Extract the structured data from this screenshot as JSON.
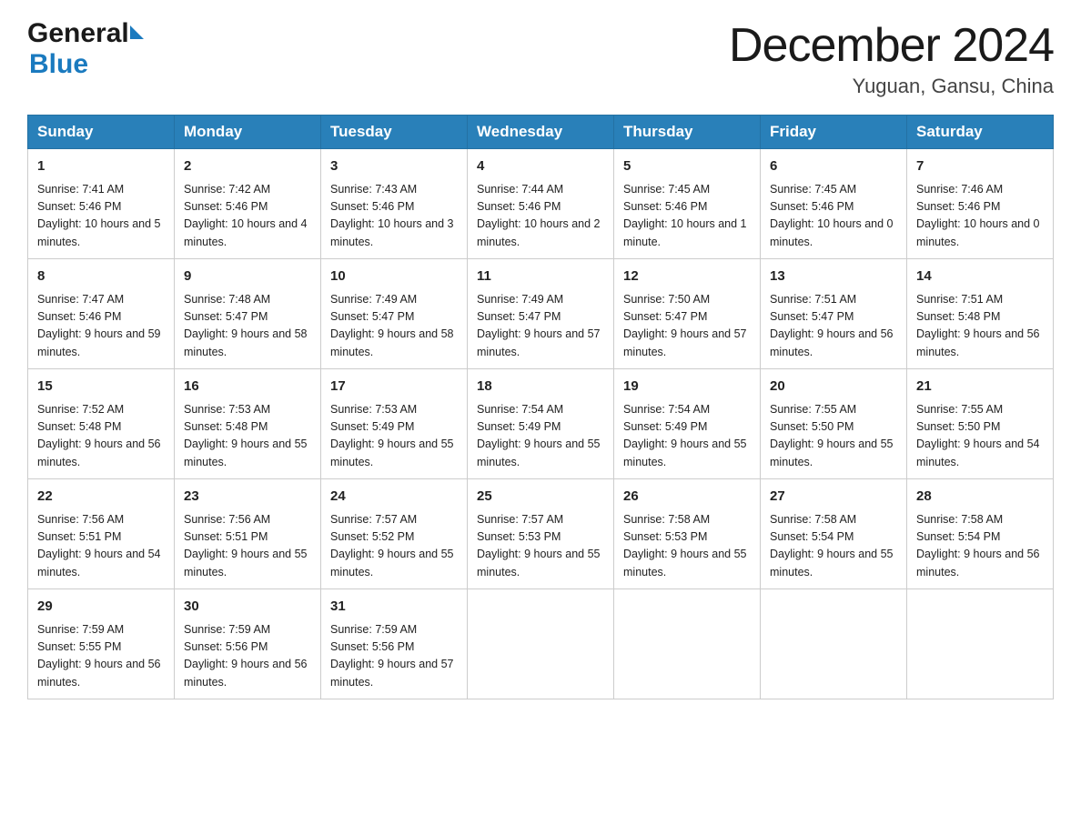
{
  "header": {
    "logo_general": "General",
    "logo_blue": "Blue",
    "month_title": "December 2024",
    "location": "Yuguan, Gansu, China"
  },
  "days_of_week": [
    "Sunday",
    "Monday",
    "Tuesday",
    "Wednesday",
    "Thursday",
    "Friday",
    "Saturday"
  ],
  "weeks": [
    [
      {
        "day": "1",
        "sunrise": "7:41 AM",
        "sunset": "5:46 PM",
        "daylight": "10 hours and 5 minutes."
      },
      {
        "day": "2",
        "sunrise": "7:42 AM",
        "sunset": "5:46 PM",
        "daylight": "10 hours and 4 minutes."
      },
      {
        "day": "3",
        "sunrise": "7:43 AM",
        "sunset": "5:46 PM",
        "daylight": "10 hours and 3 minutes."
      },
      {
        "day": "4",
        "sunrise": "7:44 AM",
        "sunset": "5:46 PM",
        "daylight": "10 hours and 2 minutes."
      },
      {
        "day": "5",
        "sunrise": "7:45 AM",
        "sunset": "5:46 PM",
        "daylight": "10 hours and 1 minute."
      },
      {
        "day": "6",
        "sunrise": "7:45 AM",
        "sunset": "5:46 PM",
        "daylight": "10 hours and 0 minutes."
      },
      {
        "day": "7",
        "sunrise": "7:46 AM",
        "sunset": "5:46 PM",
        "daylight": "10 hours and 0 minutes."
      }
    ],
    [
      {
        "day": "8",
        "sunrise": "7:47 AM",
        "sunset": "5:46 PM",
        "daylight": "9 hours and 59 minutes."
      },
      {
        "day": "9",
        "sunrise": "7:48 AM",
        "sunset": "5:47 PM",
        "daylight": "9 hours and 58 minutes."
      },
      {
        "day": "10",
        "sunrise": "7:49 AM",
        "sunset": "5:47 PM",
        "daylight": "9 hours and 58 minutes."
      },
      {
        "day": "11",
        "sunrise": "7:49 AM",
        "sunset": "5:47 PM",
        "daylight": "9 hours and 57 minutes."
      },
      {
        "day": "12",
        "sunrise": "7:50 AM",
        "sunset": "5:47 PM",
        "daylight": "9 hours and 57 minutes."
      },
      {
        "day": "13",
        "sunrise": "7:51 AM",
        "sunset": "5:47 PM",
        "daylight": "9 hours and 56 minutes."
      },
      {
        "day": "14",
        "sunrise": "7:51 AM",
        "sunset": "5:48 PM",
        "daylight": "9 hours and 56 minutes."
      }
    ],
    [
      {
        "day": "15",
        "sunrise": "7:52 AM",
        "sunset": "5:48 PM",
        "daylight": "9 hours and 56 minutes."
      },
      {
        "day": "16",
        "sunrise": "7:53 AM",
        "sunset": "5:48 PM",
        "daylight": "9 hours and 55 minutes."
      },
      {
        "day": "17",
        "sunrise": "7:53 AM",
        "sunset": "5:49 PM",
        "daylight": "9 hours and 55 minutes."
      },
      {
        "day": "18",
        "sunrise": "7:54 AM",
        "sunset": "5:49 PM",
        "daylight": "9 hours and 55 minutes."
      },
      {
        "day": "19",
        "sunrise": "7:54 AM",
        "sunset": "5:49 PM",
        "daylight": "9 hours and 55 minutes."
      },
      {
        "day": "20",
        "sunrise": "7:55 AM",
        "sunset": "5:50 PM",
        "daylight": "9 hours and 55 minutes."
      },
      {
        "day": "21",
        "sunrise": "7:55 AM",
        "sunset": "5:50 PM",
        "daylight": "9 hours and 54 minutes."
      }
    ],
    [
      {
        "day": "22",
        "sunrise": "7:56 AM",
        "sunset": "5:51 PM",
        "daylight": "9 hours and 54 minutes."
      },
      {
        "day": "23",
        "sunrise": "7:56 AM",
        "sunset": "5:51 PM",
        "daylight": "9 hours and 55 minutes."
      },
      {
        "day": "24",
        "sunrise": "7:57 AM",
        "sunset": "5:52 PM",
        "daylight": "9 hours and 55 minutes."
      },
      {
        "day": "25",
        "sunrise": "7:57 AM",
        "sunset": "5:53 PM",
        "daylight": "9 hours and 55 minutes."
      },
      {
        "day": "26",
        "sunrise": "7:58 AM",
        "sunset": "5:53 PM",
        "daylight": "9 hours and 55 minutes."
      },
      {
        "day": "27",
        "sunrise": "7:58 AM",
        "sunset": "5:54 PM",
        "daylight": "9 hours and 55 minutes."
      },
      {
        "day": "28",
        "sunrise": "7:58 AM",
        "sunset": "5:54 PM",
        "daylight": "9 hours and 56 minutes."
      }
    ],
    [
      {
        "day": "29",
        "sunrise": "7:59 AM",
        "sunset": "5:55 PM",
        "daylight": "9 hours and 56 minutes."
      },
      {
        "day": "30",
        "sunrise": "7:59 AM",
        "sunset": "5:56 PM",
        "daylight": "9 hours and 56 minutes."
      },
      {
        "day": "31",
        "sunrise": "7:59 AM",
        "sunset": "5:56 PM",
        "daylight": "9 hours and 57 minutes."
      },
      null,
      null,
      null,
      null
    ]
  ],
  "labels": {
    "sunrise": "Sunrise:",
    "sunset": "Sunset:",
    "daylight": "Daylight:"
  }
}
